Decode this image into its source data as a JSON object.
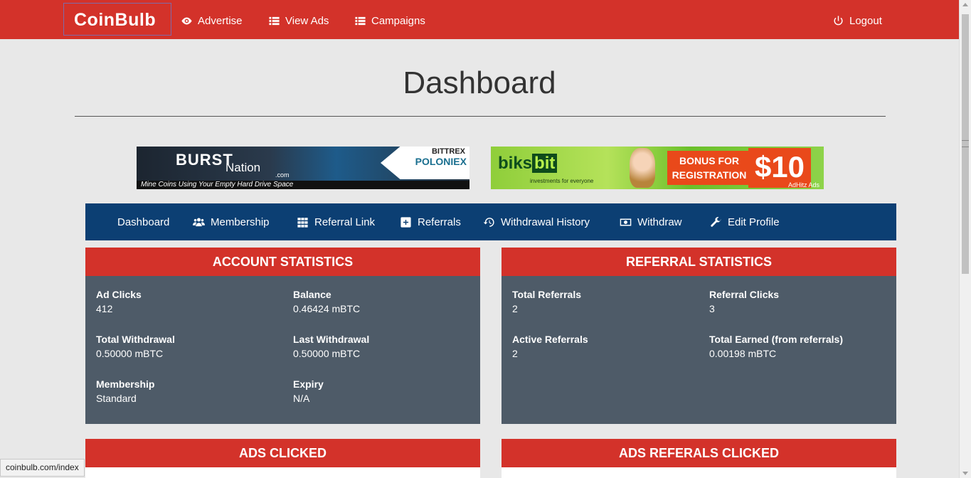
{
  "topbar": {
    "logo_text": "CoinBulb",
    "nav": [
      {
        "label": "Advertise",
        "icon": "eye-icon"
      },
      {
        "label": "View Ads",
        "icon": "list-icon"
      },
      {
        "label": "Campaigns",
        "icon": "list-icon"
      }
    ],
    "logout": {
      "label": "Logout",
      "icon": "power-icon"
    }
  },
  "page": {
    "title": "Dashboard"
  },
  "banners": {
    "burst": {
      "name": "BURST",
      "nation": "Nation",
      "com": ".com",
      "tagline": "Mine Coins Using Your Empty Hard Drive Space",
      "bittrex": "BITTREX",
      "poloniex": "POLONIEX"
    },
    "biks": {
      "brand_a": "biks",
      "brand_b": "bit",
      "sub": "investments for everyone",
      "bonus_line1": "BONUS FOR",
      "bonus_line2": "REGISTRATION",
      "amount": "$10",
      "network": "AdHitz Ads"
    }
  },
  "subnav": [
    {
      "label": "Dashboard"
    },
    {
      "label": "Membership",
      "icon": "users-icon"
    },
    {
      "label": "Referral Link",
      "icon": "grid-icon"
    },
    {
      "label": "Referrals",
      "icon": "plus-square-icon"
    },
    {
      "label": "Withdrawal History",
      "icon": "history-icon"
    },
    {
      "label": "Withdraw",
      "icon": "money-icon"
    },
    {
      "label": "Edit Profile",
      "icon": "wrench-icon"
    }
  ],
  "account_stats": {
    "title": "ACCOUNT STATISTICS",
    "ad_clicks": {
      "label": "Ad Clicks",
      "value": "412"
    },
    "balance": {
      "label": "Balance",
      "value": "0.46424 mBTC"
    },
    "total_withdrawal": {
      "label": "Total Withdrawal",
      "value": "0.50000 mBTC"
    },
    "last_withdrawal": {
      "label": "Last Withdrawal",
      "value": "0.50000 mBTC"
    },
    "membership": {
      "label": "Membership",
      "value": "Standard"
    },
    "expiry": {
      "label": "Expiry",
      "value": "N/A"
    }
  },
  "referral_stats": {
    "title": "REFERRAL STATISTICS",
    "total_referrals": {
      "label": "Total Referrals",
      "value": "2"
    },
    "referral_clicks": {
      "label": "Referral Clicks",
      "value": "3"
    },
    "active_referrals": {
      "label": "Active Referrals",
      "value": "2"
    },
    "total_earned": {
      "label": "Total Earned (from referrals)",
      "value": "0.00198 mBTC"
    }
  },
  "ads_clicked": {
    "title": "ADS CLICKED"
  },
  "ads_ref_clicked": {
    "title": "ADS REFERALS CLICKED"
  },
  "statusbar": {
    "url": "coinbulb.com/index"
  },
  "colors": {
    "red": "#d3322a",
    "navy": "#0c3f73",
    "panel": "#4e5b68",
    "background": "#e8e8e8"
  }
}
